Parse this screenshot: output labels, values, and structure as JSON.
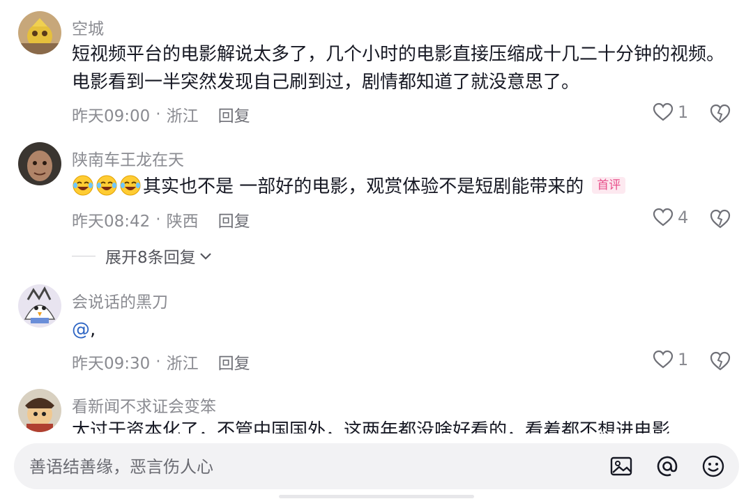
{
  "comments": [
    {
      "username": "空城",
      "text": "短视频平台的电影解说太多了，几个小时的电影直接压缩成十几二十分钟的视频。电影看到一半突然发现自己刷到过，剧情都知道了就没意思了。",
      "time": "昨天09:00",
      "location": "浙江",
      "reply_label": "回复",
      "likes": "1"
    },
    {
      "username": "陕南车王龙在天",
      "emojis": [
        "laugh-cry-emoji",
        "laugh-cry-emoji",
        "laugh-cry-emoji"
      ],
      "text": "其实也不是 一部好的电影，观赏体验不是短剧能带来的",
      "badge": "首评",
      "time": "昨天08:42",
      "location": "陕西",
      "reply_label": "回复",
      "likes": "4",
      "expand_label": "展开8条回复"
    },
    {
      "username": "会说话的黑刀",
      "mention": "@",
      "text": ",",
      "time": "昨天09:30",
      "location": "浙江",
      "reply_label": "回复",
      "likes": "1"
    },
    {
      "username": "看新闻不求证会变笨",
      "text": "太过于资本化了，不管中国国外，这两年都没啥好看的，看着都不想进电影"
    }
  ],
  "input_bar": {
    "placeholder": "善语结善缘，恶言伤人心",
    "icons": [
      "image-icon",
      "at-icon",
      "emoji-icon"
    ]
  },
  "colors": {
    "meta_gray": "#8a8b91",
    "badge_pink": "#e8508b",
    "mention_blue": "#2f66c4",
    "input_bg": "#f2f2f4"
  }
}
